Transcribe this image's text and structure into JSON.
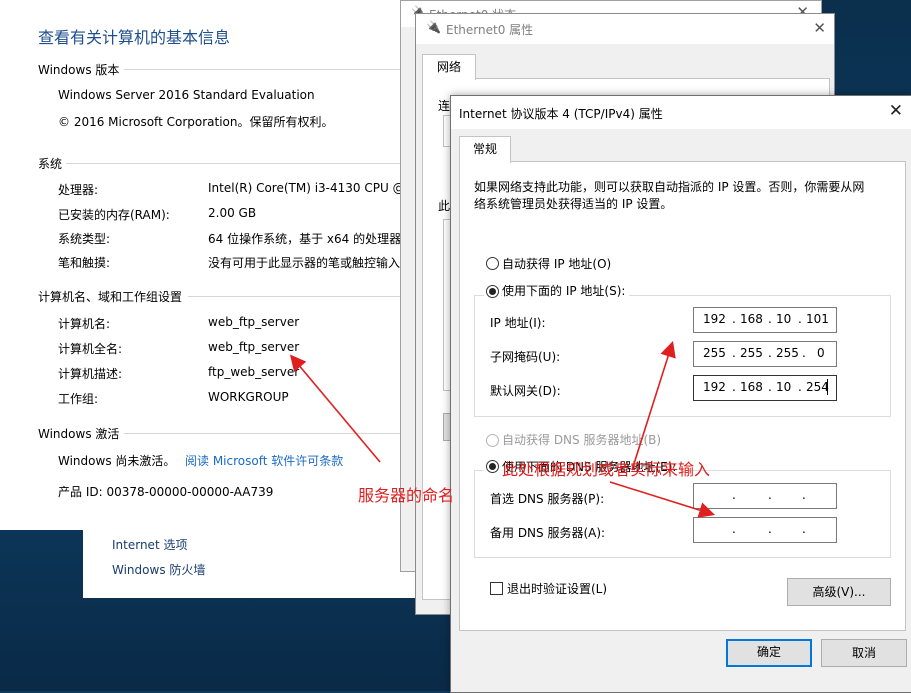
{
  "system": {
    "title": "查看有关计算机的基本信息",
    "edition_section": "Windows 版本",
    "edition_name": "Windows Server 2016 Standard Evaluation",
    "copyright": "© 2016 Microsoft Corporation。保留所有权利。",
    "system_section": "系统",
    "rows": [
      {
        "label": "处理器:",
        "value": "Intel(R) Core(TM) i3-4130 CPU @"
      },
      {
        "label": "已安装的内存(RAM):",
        "value": "2.00 GB"
      },
      {
        "label": "系统类型:",
        "value": "64 位操作系统，基于 x64 的处理器"
      },
      {
        "label": "笔和触摸:",
        "value": "没有可用于此显示器的笔或触控输入"
      }
    ],
    "name_section": "计算机名、域和工作组设置",
    "name_rows": [
      {
        "label": "计算机名:",
        "value": "web_ftp_server"
      },
      {
        "label": "计算机全名:",
        "value": "web_ftp_server"
      },
      {
        "label": "计算机描述:",
        "value": "ftp_web_server"
      },
      {
        "label": "工作组:",
        "value": "WORKGROUP"
      }
    ],
    "activation_section": "Windows 激活",
    "activation_status": "Windows 尚未激活。",
    "activation_link": "阅读 Microsoft 软件许可条款",
    "product_id": "产品 ID: 00378-00000-00000-AA739",
    "see_also": [
      "Internet 选项",
      "Windows 防火墙"
    ]
  },
  "status_window": {
    "title": "Ethernet0 状态"
  },
  "props_window": {
    "title": "Ethernet0 属性",
    "tab": "网络",
    "partial_labels": [
      "连",
      "此"
    ]
  },
  "ipv4": {
    "title": "Internet 协议版本 4 (TCP/IPv4) 属性",
    "tab": "常规",
    "description": "如果网络支持此功能，则可以获取自动指派的 IP 设置。否则，你需要从网络系统管理员处获得适当的 IP 设置。",
    "auto_ip": "自动获得 IP 地址(O)",
    "manual_ip": "使用下面的 IP 地址(S):",
    "ip_label": "IP 地址(I):",
    "ip_octets": [
      "192",
      "168",
      "10",
      "101"
    ],
    "mask_label": "子网掩码(U):",
    "mask_octets": [
      "255",
      "255",
      "255",
      "0"
    ],
    "gw_label": "默认网关(D):",
    "gw_octets": [
      "192",
      "168",
      "10",
      "254"
    ],
    "auto_dns": "自动获得 DNS 服务器地址(B)",
    "manual_dns": "使用下面的 DNS 服务器地址(E):",
    "dns1_label": "首选 DNS 服务器(P):",
    "dns2_label": "备用 DNS 服务器(A):",
    "validate": "退出时验证设置(L)",
    "advanced": "高级(V)...",
    "ok": "确定",
    "cancel": "取消"
  },
  "annotations": {
    "server_name": "服务器的命名",
    "plan_input": "此处根据规划或者实际来输入"
  },
  "colors": {
    "annotation": "#e02020",
    "link": "#1a6bc4",
    "title": "#1e4e8c",
    "accent": "#0078d7"
  }
}
